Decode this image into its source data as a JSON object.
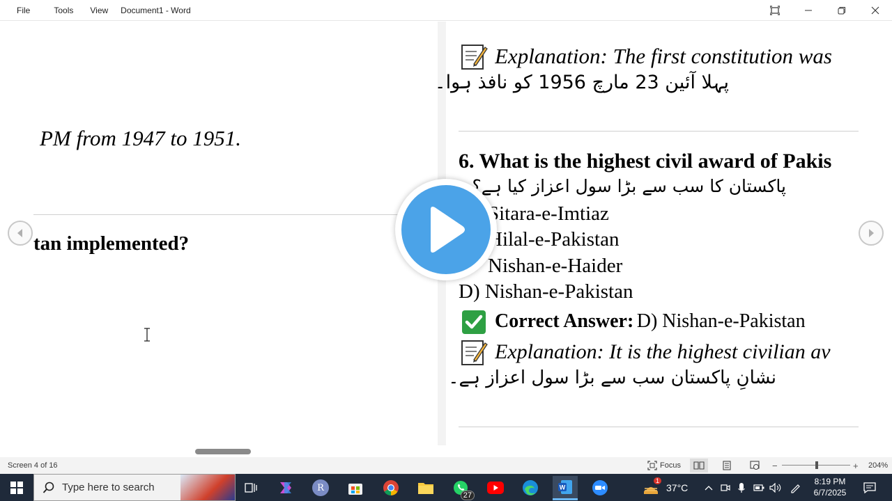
{
  "titlebar": {
    "menu": [
      "File",
      "Tools",
      "View"
    ],
    "doc_title": "Document1  -  Word"
  },
  "left_page": {
    "pm_text": "PM from 1947 to 1951.",
    "question_tail": "tan implemented?"
  },
  "right_page": {
    "explanation_top_label": "Explanation: The first constitution was",
    "urdu_constitution": "پہلا آئین 23 مارچ 1956 کو نافذ ہوا۔",
    "question_6": "6. What is the highest civil award of Pakis",
    "urdu_question_6": "پاکستان کا سب سے بڑا سول اعزاز کیا ہے؟",
    "options": [
      "Sitara-e-Imtiaz",
      "Hilal-e-Pakistan",
      "Nishan-e-Haider",
      "D) Nishan-e-Pakistan"
    ],
    "correct_label": "Correct Answer:",
    "correct_value": "D) Nishan-e-Pakistan",
    "explanation_bottom_label": "Explanation: It is the highest civilian av",
    "urdu_explanation": "نشانِ پاکستان سب سے بڑا سول اعزاز ہے۔"
  },
  "statusbar": {
    "screen": "Screen 4 of 16",
    "focus": "Focus",
    "zoom": "204%"
  },
  "taskbar": {
    "search_placeholder": "Type here to search",
    "whatsapp_badge": "27",
    "weather_badge": "1",
    "temperature": "37°C",
    "time": "8:19 PM",
    "date": "6/7/2025"
  },
  "colors": {
    "accent_word": "#2b579a",
    "play_blue": "#4ba3e8",
    "check_green": "#2ea043",
    "taskbar_bg": "#1f2a3a"
  }
}
